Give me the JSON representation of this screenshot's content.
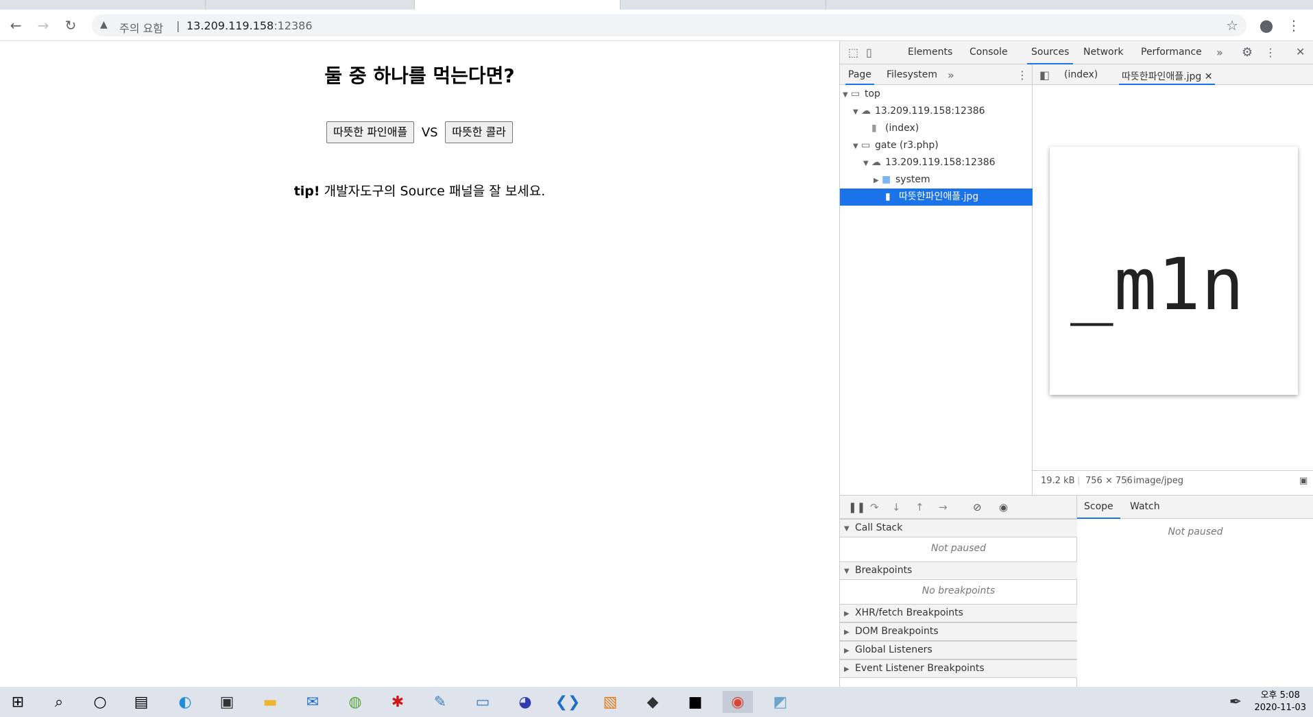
{
  "browser": {
    "address": {
      "warning_label": "주의 요함",
      "separator": "|",
      "url_host": "13.209.119.158",
      "url_port": ":12386"
    }
  },
  "page": {
    "title": "둘 중 하나를 먹는다면?",
    "choice_a": "따뜻한 파인애플",
    "vs_label": "VS",
    "choice_b": "따뜻한 콜라",
    "tip_bold": "tip!",
    "tip_text": " 개발자도구의 Source 패널을 잘 보세요."
  },
  "devtools": {
    "tabs": [
      "Elements",
      "Console",
      "Sources",
      "Network",
      "Performance"
    ],
    "active_tab": "Sources",
    "navigator_tabs": [
      "Page",
      "Filesystem"
    ],
    "tree": [
      {
        "label": "top"
      },
      {
        "label": "13.209.119.158:12386"
      },
      {
        "label": "(index)"
      },
      {
        "label": "gate (r3.php)"
      },
      {
        "label": "13.209.119.158:12386"
      },
      {
        "label": "system"
      },
      {
        "label": "따뜻한파인애플.jpg"
      }
    ],
    "editor_tabs": [
      "(index)",
      "따뜻한파인애플.jpg"
    ],
    "preview_text": "_m1n",
    "preview_status": {
      "size": "19.2 kB",
      "dimensions": "756 × 756",
      "mime": "image/jpeg"
    },
    "sections": {
      "call_stack": "Call Stack",
      "call_stack_note": "Not paused",
      "breakpoints": "Breakpoints",
      "breakpoints_note": "No breakpoints",
      "xhr": "XHR/fetch Breakpoints",
      "dom": "DOM Breakpoints",
      "global": "Global Listeners",
      "event": "Event Listener Breakpoints"
    },
    "scope_tabs": [
      "Scope",
      "Watch"
    ],
    "scope_note": "Not paused"
  },
  "taskbar": {
    "clock_period": "오후 5:08",
    "clock_date": "2020-11-03"
  }
}
